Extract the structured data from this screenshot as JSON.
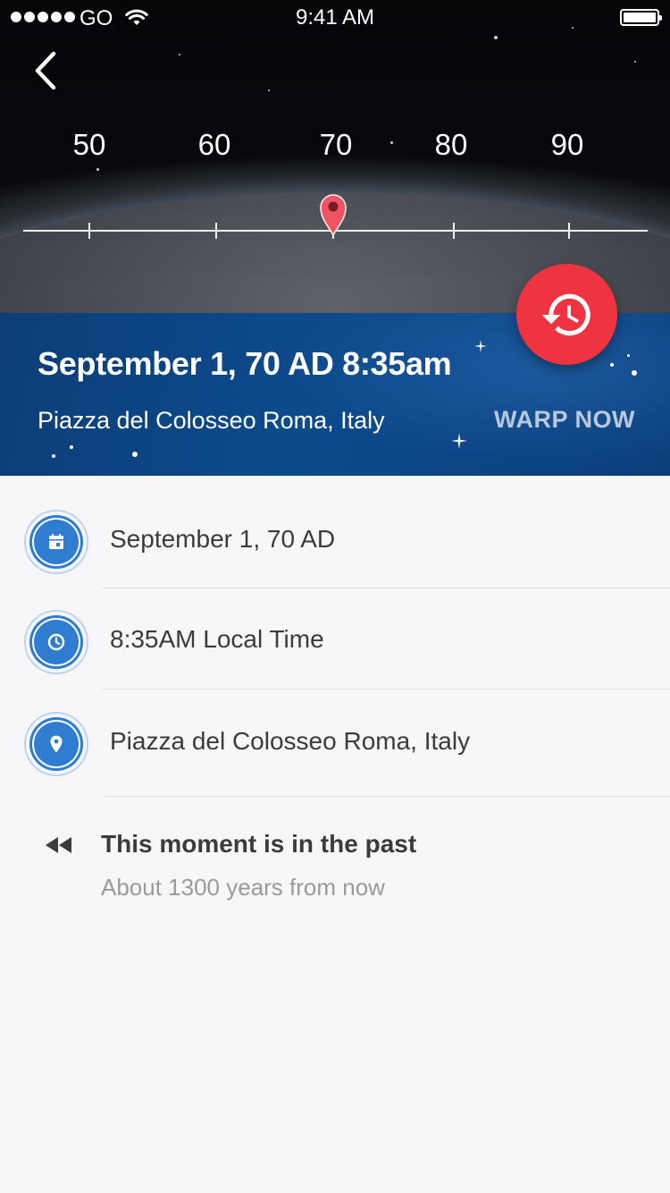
{
  "status_bar": {
    "carrier": "GO",
    "time": "9:41 AM"
  },
  "timeline": {
    "labels": [
      "50",
      "60",
      "70",
      "80",
      "90"
    ],
    "selected": "70"
  },
  "header": {
    "title": "September 1, 70 AD 8:35am",
    "location": "Piazza del Colosseo Roma, Italy",
    "warp_label": "WARP NOW"
  },
  "details": [
    {
      "icon": "calendar-icon",
      "text": "September 1, 70 AD"
    },
    {
      "icon": "clock-icon",
      "text": "8:35AM Local Time"
    },
    {
      "icon": "location-icon",
      "text": "Piazza del Colosseo Roma, Italy"
    }
  ],
  "moment": {
    "icon": "rewind-icon",
    "title": "This moment is in the past",
    "subtitle": "About 1300 years from now"
  },
  "colors": {
    "accent_red": "#ef3340",
    "band_blue": "#0d4a8c",
    "badge_blue": "#2e7dd1"
  }
}
